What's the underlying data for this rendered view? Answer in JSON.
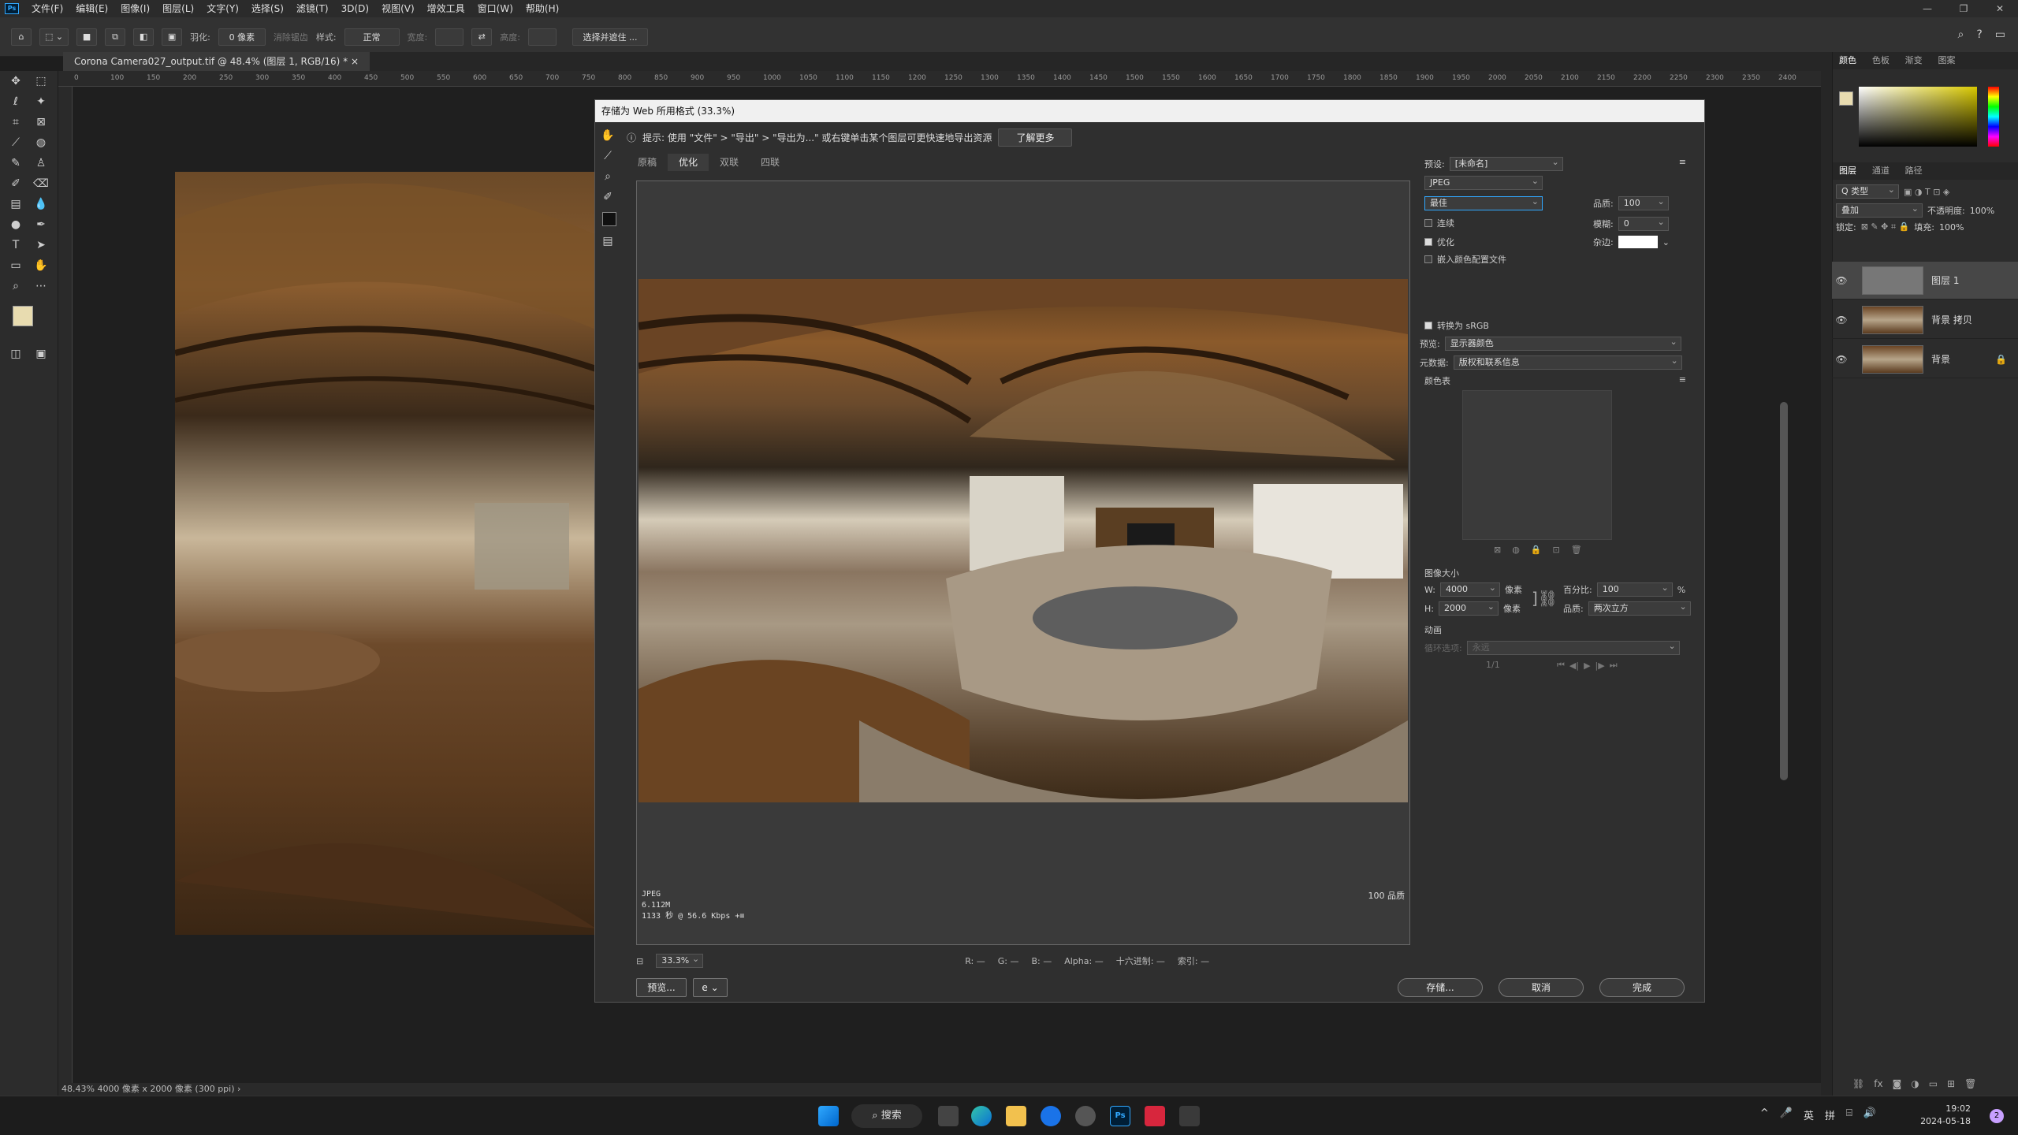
{
  "app": {
    "menu": [
      "文件(F)",
      "编辑(E)",
      "图像(I)",
      "图层(L)",
      "文字(Y)",
      "选择(S)",
      "滤镜(T)",
      "3D(D)",
      "视图(V)",
      "增效工具",
      "窗口(W)",
      "帮助(H)"
    ],
    "window_controls": [
      "—",
      "❐",
      "✕"
    ]
  },
  "options_bar": {
    "feather_label": "羽化:",
    "feather_value": "0 像素",
    "antialias_label": "消除锯齿",
    "style_label": "样式:",
    "style_value": "正常",
    "width_label": "宽度:",
    "height_label": "高度:",
    "select_mask_button": "选择并遮住 ..."
  },
  "document_tab": "Corona Camera027_output.tif @ 48.4% (图层 1, RGB/16) *",
  "ruler_top": [
    "0",
    "100",
    "150",
    "200",
    "250",
    "300",
    "350",
    "400",
    "450",
    "500",
    "550",
    "600",
    "650",
    "700",
    "750",
    "800",
    "850",
    "900",
    "950",
    "1000",
    "1050",
    "1100",
    "1150",
    "1200",
    "1250",
    "1300",
    "1350",
    "1400",
    "1450",
    "1500",
    "1550",
    "1600",
    "1650",
    "1700",
    "1750",
    "1800",
    "1850",
    "1900",
    "1950",
    "2000",
    "2050",
    "2100",
    "2150",
    "2200",
    "2250",
    "2300",
    "2350",
    "2400"
  ],
  "status_bar": "48.43%  4000 像素 x 2000 像素 (300 ppi)  ›",
  "dialog": {
    "title": "存储为 Web 所用格式 (33.3%)",
    "tip": "提示:  使用 \"文件\" > \"导出\" > \"导出为...\" 或右键单击某个图层可更快速地导出资源",
    "learn_more": "了解更多",
    "tabs": [
      "原稿",
      "优化",
      "双联",
      "四联"
    ],
    "preview_info": [
      "JPEG",
      "6.112M",
      "1133 秒 @ 56.6 Kbps"
    ],
    "preview_info_menu": "+≡",
    "preview_quality": "100 品质",
    "zoom": "33.3%",
    "readouts": [
      "R: —",
      "G: —",
      "B: —",
      "Alpha: —",
      "十六进制: —",
      "索引: —"
    ],
    "preview_button": "预览...",
    "browser_icon_label": "e",
    "save_button": "存储...",
    "cancel_button": "取消",
    "done_button": "完成",
    "settings": {
      "preset_label": "预设:",
      "preset_value": "[未命名]",
      "format": "JPEG",
      "quality_level": "最佳",
      "quality_label": "品质:",
      "quality_value": "100",
      "progressive_label": "连续",
      "blur_label": "模糊:",
      "blur_value": "0",
      "optimized_label": "优化",
      "matte_label": "杂边:",
      "embed_profile_label": "嵌入颜色配置文件",
      "convert_srgb_label": "转换为 sRGB",
      "preview_label": "预览:",
      "preview_value": "显示器颜色",
      "metadata_label": "元数据:",
      "metadata_value": "版权和联系信息",
      "color_table_label": "颜色表",
      "image_size_label": "图像大小",
      "w_label": "W:",
      "w_value": "4000",
      "h_label": "H:",
      "h_value": "2000",
      "px": "像素",
      "percent_label": "百分比:",
      "percent_value": "100",
      "percent_unit": "%",
      "quality2_label": "品质:",
      "quality2_value": "两次立方",
      "animation_label": "动画",
      "loop_label": "循环选项:",
      "loop_value": "永远",
      "frame_counter": "1/1"
    }
  },
  "right_panel": {
    "color_tabs": [
      "颜色",
      "色板",
      "渐变",
      "图案"
    ],
    "layer_tabs": [
      "图层",
      "通道",
      "路径"
    ],
    "kind_label": "Q 类型",
    "blend_mode": "叠加",
    "opacity_label": "不透明度:",
    "opacity_value": "100%",
    "lock_label": "锁定:",
    "fill_label": "填充:",
    "fill_value": "100%",
    "layers": [
      {
        "name": "图层 1"
      },
      {
        "name": "背景 拷贝"
      },
      {
        "name": "背景"
      }
    ]
  },
  "taskbar": {
    "search": "搜索",
    "lang1": "英",
    "lang2": "拼",
    "time": "19:02",
    "date": "2024-05-18",
    "notif_count": "2"
  },
  "colors": {
    "accent": "#31a8ff",
    "fg_swatch": "#e8dcb0",
    "bg_swatch": "#ffffff"
  }
}
